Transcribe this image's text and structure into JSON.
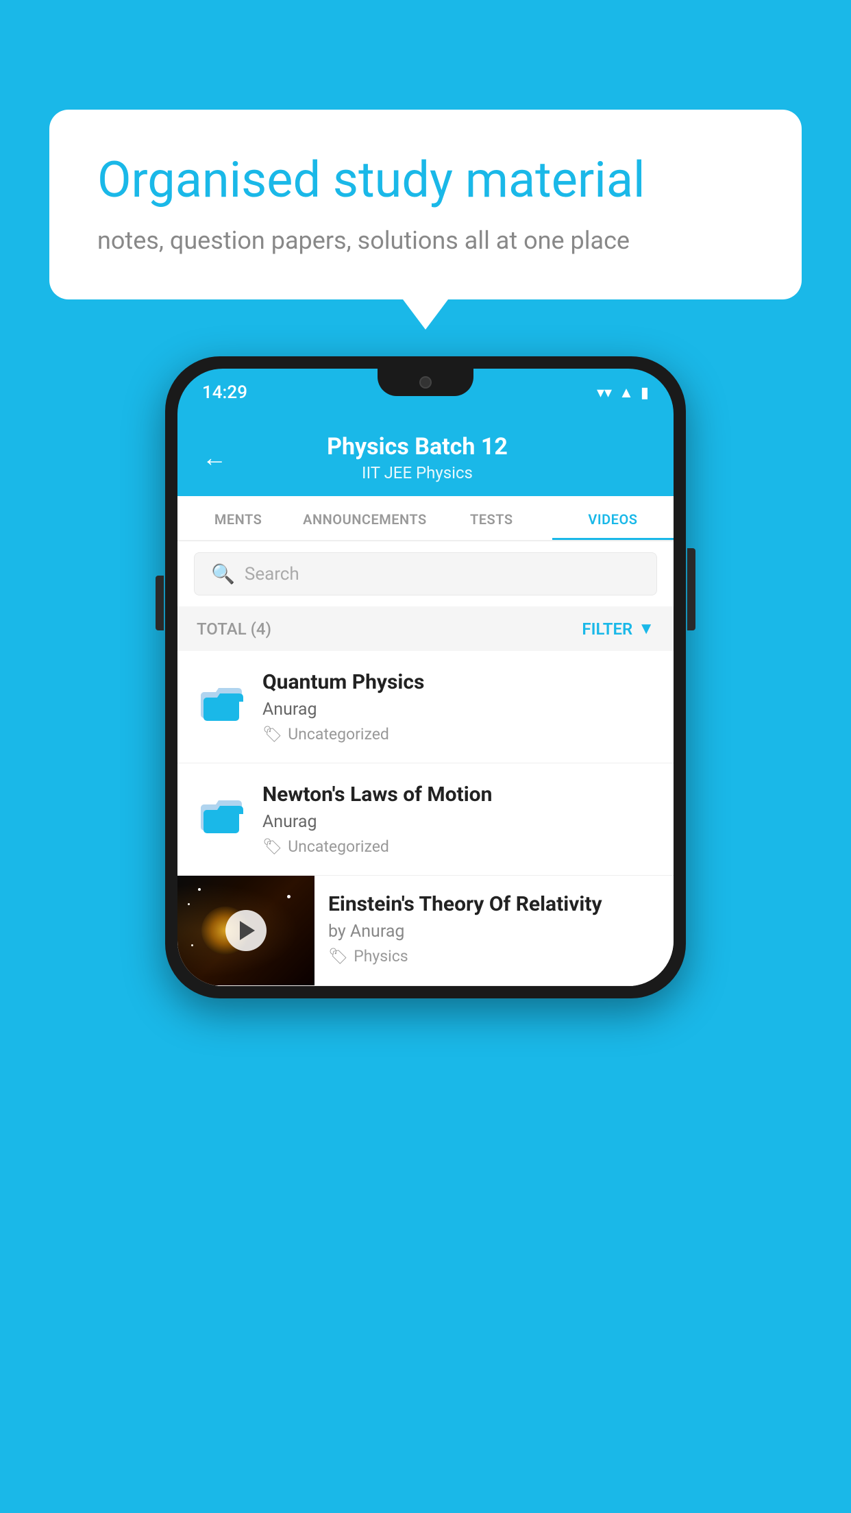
{
  "background_color": "#1ab8e8",
  "bubble": {
    "title": "Organised study material",
    "subtitle": "notes, question papers, solutions all at one place"
  },
  "phone": {
    "status_bar": {
      "time": "14:29",
      "wifi_icon": "▼",
      "signal_icon": "▲",
      "battery_icon": "▮"
    },
    "header": {
      "title": "Physics Batch 12",
      "subtitle": "IIT JEE    Physics",
      "back_label": "←"
    },
    "tabs": [
      {
        "label": "MENTS",
        "active": false
      },
      {
        "label": "ANNOUNCEMENTS",
        "active": false
      },
      {
        "label": "TESTS",
        "active": false
      },
      {
        "label": "VIDEOS",
        "active": true
      }
    ],
    "search": {
      "placeholder": "Search"
    },
    "filter_bar": {
      "total_label": "TOTAL (4)",
      "filter_label": "FILTER"
    },
    "videos": [
      {
        "title": "Quantum Physics",
        "author": "Anurag",
        "tag": "Uncategorized",
        "has_thumbnail": false
      },
      {
        "title": "Newton's Laws of Motion",
        "author": "Anurag",
        "tag": "Uncategorized",
        "has_thumbnail": false
      },
      {
        "title": "Einstein's Theory Of Relativity",
        "author": "by Anurag",
        "tag": "Physics",
        "has_thumbnail": true
      }
    ]
  }
}
